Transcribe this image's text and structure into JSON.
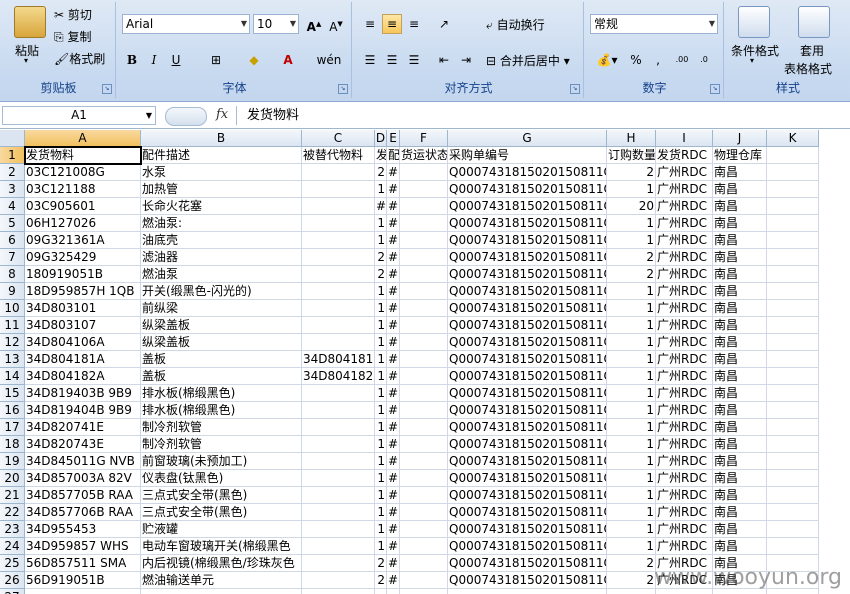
{
  "ribbon": {
    "clipboard": {
      "paste": "粘贴",
      "cut": "剪切",
      "copy": "复制",
      "format_painter": "格式刷",
      "title": "剪贴板"
    },
    "font": {
      "name": "Arial",
      "size": "10",
      "title": "字体"
    },
    "alignment": {
      "wrap": "自动换行",
      "merge": "合并后居中",
      "title": "对齐方式"
    },
    "number": {
      "format": "常规",
      "percent": "%",
      "comma": ",",
      "title": "数字"
    },
    "styles": {
      "conditional": "条件格式",
      "table": "套用",
      "table2": "表格格式",
      "title": "样式"
    }
  },
  "formula_bar": {
    "name_box": "A1",
    "fx": "fx",
    "content": "发货物料"
  },
  "columns": [
    {
      "label": "A",
      "active": true
    },
    {
      "label": "B"
    },
    {
      "label": "C"
    },
    {
      "label": "D"
    },
    {
      "label": "E"
    },
    {
      "label": "F"
    },
    {
      "label": "G"
    },
    {
      "label": "H"
    },
    {
      "label": "I"
    },
    {
      "label": "J"
    },
    {
      "label": "K"
    }
  ],
  "rows": [
    {
      "n": "1",
      "cells": [
        "发货物料",
        "配件描述",
        "被替代物料",
        "发",
        "配",
        "货运状态",
        "采购单编号",
        "订购数量",
        "发货RDC",
        "物理仓库"
      ]
    },
    {
      "n": "2",
      "cells": [
        "03C121008G",
        "水泵",
        "",
        "2",
        "#",
        "",
        "Q0007431815020150811O",
        "2",
        "广州RDC",
        "南昌"
      ]
    },
    {
      "n": "3",
      "cells": [
        "03C121188",
        "加热管",
        "",
        "1",
        "#",
        "",
        "Q0007431815020150811O",
        "1",
        "广州RDC",
        "南昌"
      ]
    },
    {
      "n": "4",
      "cells": [
        "03C905601",
        "长命火花塞",
        "",
        "#",
        "#",
        "",
        "Q0007431815020150811O",
        "20",
        "广州RDC",
        "南昌"
      ]
    },
    {
      "n": "5",
      "cells": [
        "06H127026",
        "燃油泵:",
        "",
        "1",
        "#",
        "",
        "Q0007431815020150811O",
        "1",
        "广州RDC",
        "南昌"
      ]
    },
    {
      "n": "6",
      "cells": [
        "09G321361A",
        "油底壳",
        "",
        "1",
        "#",
        "",
        "Q0007431815020150811O",
        "1",
        "广州RDC",
        "南昌"
      ]
    },
    {
      "n": "7",
      "cells": [
        "09G325429",
        "滤油器",
        "",
        "2",
        "#",
        "",
        "Q0007431815020150811O",
        "2",
        "广州RDC",
        "南昌"
      ]
    },
    {
      "n": "8",
      "cells": [
        "180919051B",
        "燃油泵",
        "",
        "2",
        "#",
        "",
        "Q0007431815020150811O",
        "2",
        "广州RDC",
        "南昌"
      ]
    },
    {
      "n": "9",
      "cells": [
        "18D959857H 1QB",
        "开关(缎黑色-闪光的)",
        "",
        "1",
        "#",
        "",
        "Q0007431815020150811O",
        "1",
        "广州RDC",
        "南昌"
      ]
    },
    {
      "n": "10",
      "cells": [
        "34D803101",
        "前纵梁",
        "",
        "1",
        "#",
        "",
        "Q0007431815020150811O",
        "1",
        "广州RDC",
        "南昌"
      ]
    },
    {
      "n": "11",
      "cells": [
        "34D803107",
        "纵梁盖板",
        "",
        "1",
        "#",
        "",
        "Q0007431815020150811O",
        "1",
        "广州RDC",
        "南昌"
      ]
    },
    {
      "n": "12",
      "cells": [
        "34D804106A",
        "纵梁盖板",
        "",
        "1",
        "#",
        "",
        "Q0007431815020150811O",
        "1",
        "广州RDC",
        "南昌"
      ]
    },
    {
      "n": "13",
      "cells": [
        "34D804181A",
        "盖板",
        "34D804181",
        "1",
        "#",
        "",
        "Q0007431815020150811O",
        "1",
        "广州RDC",
        "南昌"
      ]
    },
    {
      "n": "14",
      "cells": [
        "34D804182A",
        "盖板",
        "34D804182",
        "1",
        "#",
        "",
        "Q0007431815020150811O",
        "1",
        "广州RDC",
        "南昌"
      ]
    },
    {
      "n": "15",
      "cells": [
        "34D819403B 9B9",
        "排水板(棉缎黑色)",
        "",
        "1",
        "#",
        "",
        "Q0007431815020150811O",
        "1",
        "广州RDC",
        "南昌"
      ]
    },
    {
      "n": "16",
      "cells": [
        "34D819404B 9B9",
        "排水板(棉缎黑色)",
        "",
        "1",
        "#",
        "",
        "Q0007431815020150811O",
        "1",
        "广州RDC",
        "南昌"
      ]
    },
    {
      "n": "17",
      "cells": [
        "34D820741E",
        "制冷剂软管",
        "",
        "1",
        "#",
        "",
        "Q0007431815020150811O",
        "1",
        "广州RDC",
        "南昌"
      ]
    },
    {
      "n": "18",
      "cells": [
        "34D820743E",
        "制冷剂软管",
        "",
        "1",
        "#",
        "",
        "Q0007431815020150811O",
        "1",
        "广州RDC",
        "南昌"
      ]
    },
    {
      "n": "19",
      "cells": [
        "34D845011G NVB",
        "前窗玻璃(未预加工)",
        "",
        "1",
        "#",
        "",
        "Q0007431815020150811O",
        "1",
        "广州RDC",
        "南昌"
      ]
    },
    {
      "n": "20",
      "cells": [
        "34D857003A 82V",
        "仪表盘(钛黑色)",
        "",
        "1",
        "#",
        "",
        "Q0007431815020150811O",
        "1",
        "广州RDC",
        "南昌"
      ]
    },
    {
      "n": "21",
      "cells": [
        "34D857705B RAA",
        "三点式安全带(黑色)",
        "",
        "1",
        "#",
        "",
        "Q0007431815020150811O",
        "1",
        "广州RDC",
        "南昌"
      ]
    },
    {
      "n": "22",
      "cells": [
        "34D857706B RAA",
        "三点式安全带(黑色)",
        "",
        "1",
        "#",
        "",
        "Q0007431815020150811O",
        "1",
        "广州RDC",
        "南昌"
      ]
    },
    {
      "n": "23",
      "cells": [
        "34D955453",
        "贮液罐",
        "",
        "1",
        "#",
        "",
        "Q0007431815020150811O",
        "1",
        "广州RDC",
        "南昌"
      ]
    },
    {
      "n": "24",
      "cells": [
        "34D959857  WHS",
        "电动车窗玻璃开关(棉缎黑色",
        "",
        "1",
        "#",
        "",
        "Q0007431815020150811O",
        "1",
        "广州RDC",
        "南昌"
      ]
    },
    {
      "n": "25",
      "cells": [
        "56D857511  SMA",
        "内后视镜(棉缎黑色/珍珠灰色",
        "",
        "2",
        "#",
        "",
        "Q0007431815020150811O",
        "2",
        "广州RDC",
        "南昌"
      ]
    },
    {
      "n": "26",
      "cells": [
        "56D919051B",
        "燃油输送单元",
        "",
        "2",
        "#",
        "",
        "Q0007431815020150811O",
        "2",
        "广州RDC",
        "南昌"
      ]
    },
    {
      "n": "27",
      "cells": [
        "",
        "",
        "",
        "",
        "",
        "",
        "",
        "",
        "",
        ""
      ]
    }
  ],
  "watermark": "www.wooyun.org"
}
